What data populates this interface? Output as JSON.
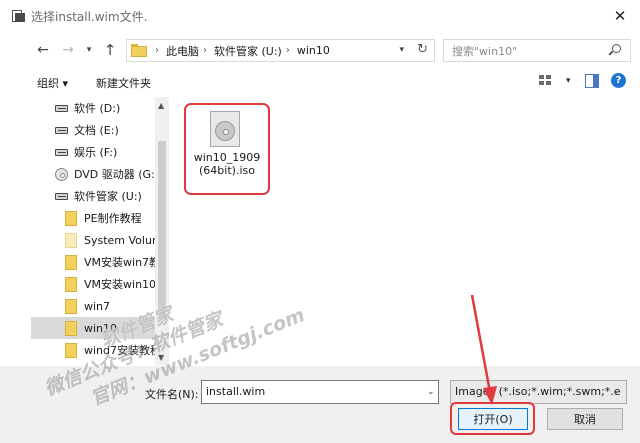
{
  "window": {
    "title": "选择install.wim文件.",
    "close_label": "✕"
  },
  "address": {
    "crumbs": [
      "此电脑",
      "软件管家 (U:)",
      "win10"
    ],
    "refresh_label": "↻"
  },
  "search": {
    "placeholder": "搜索\"win10\""
  },
  "toolbar": {
    "organize_label": "组织 ▾",
    "new_folder_label": "新建文件夹",
    "help_label": "?"
  },
  "nav": {
    "items": [
      {
        "label": "软件 (D:)",
        "kind": "drive"
      },
      {
        "label": "文档 (E:)",
        "kind": "drive"
      },
      {
        "label": "娱乐 (F:)",
        "kind": "drive"
      },
      {
        "label": "DVD 驱动器 (G:",
        "kind": "dvd"
      },
      {
        "label": "软件管家 (U:)",
        "kind": "drive"
      },
      {
        "label": "PE制作教程",
        "kind": "folder"
      },
      {
        "label": "System Volun",
        "kind": "folder-pale"
      },
      {
        "label": "VM安装win7教",
        "kind": "folder"
      },
      {
        "label": "VM安装win10",
        "kind": "folder"
      },
      {
        "label": "win7",
        "kind": "folder"
      },
      {
        "label": "win10",
        "kind": "folder",
        "selected": true
      },
      {
        "label": "wind7安装教程",
        "kind": "folder"
      }
    ]
  },
  "files": [
    {
      "name": "win10_1909(64bit).iso",
      "icon": "disc-image-icon",
      "highlighted": true
    }
  ],
  "bottom": {
    "filename_label": "文件名(N):",
    "filename_value": "install.wim",
    "filetype_value": "Images (*.iso;*.wim;*.swm;*.e",
    "open_label": "打开(O)",
    "cancel_label": "取消"
  },
  "watermark": {
    "line1": "软件管家",
    "line2": "微信公众号：软件管家",
    "line3": "官网：www.softgj.com"
  },
  "colors": {
    "highlight": "#e0393e",
    "accent": "#0078d7",
    "folder": "#f3cf5c"
  }
}
